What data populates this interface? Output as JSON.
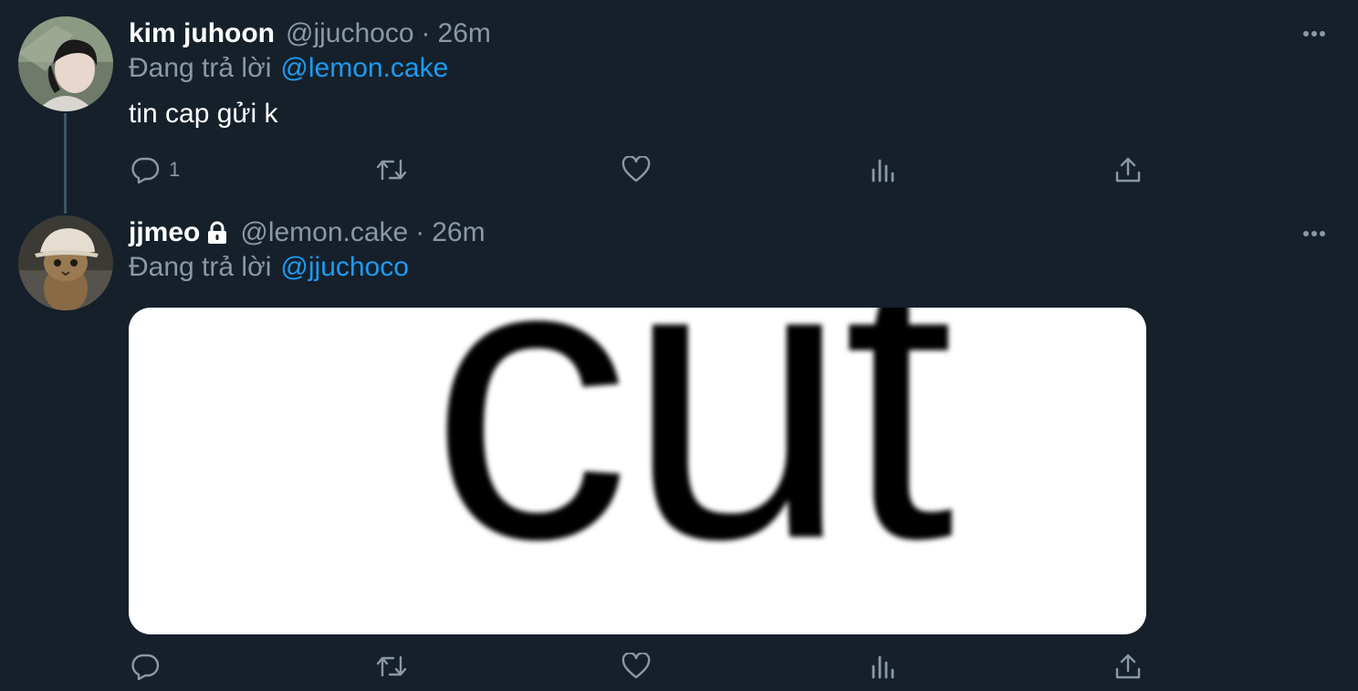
{
  "tweets": [
    {
      "display_name": "kim juhoon",
      "handle": "@jjuchoco",
      "separator": "·",
      "time": "26m",
      "reply_prefix": "Đang trả lời",
      "reply_to": "@lemon.cake",
      "text": "tin cap gửi k",
      "reply_count": "1",
      "avatar_icon": "person-photo-icon",
      "locked": false
    },
    {
      "display_name": "jjmeo",
      "handle": "@lemon.cake",
      "separator": "·",
      "time": "26m",
      "reply_prefix": "Đang trả lời",
      "reply_to": "@jjuchoco",
      "media_text": "cút",
      "reply_count": "",
      "avatar_icon": "cat-photo-icon",
      "locked": true
    }
  ],
  "icons": {
    "reply": "reply-icon",
    "retweet": "retweet-icon",
    "like": "like-icon",
    "views": "views-icon",
    "share": "share-icon",
    "more": "more-icon",
    "lock": "lock-icon"
  },
  "colors": {
    "background": "#15202b",
    "secondary_text": "#8b98a5",
    "link": "#1d9bf0",
    "thread_line": "#3d5466"
  }
}
